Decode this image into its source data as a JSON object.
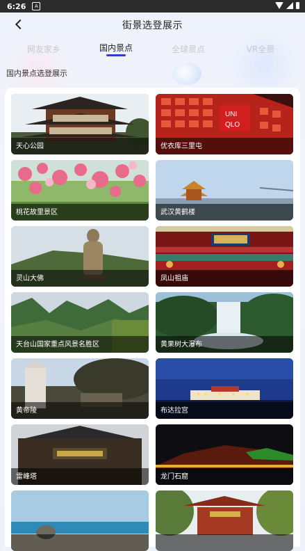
{
  "status_bar": {
    "time": "6:26",
    "notification_letter": "A"
  },
  "app_bar": {
    "title": "街景选登展示"
  },
  "tabs": [
    {
      "label": "网友家乡",
      "active": false
    },
    {
      "label": "国内景点",
      "active": true
    },
    {
      "label": "全球景点",
      "active": false
    },
    {
      "label": "VR全景",
      "active": false
    }
  ],
  "section": {
    "heading": "国内景点选登展示"
  },
  "colors": {
    "accent": "#2f3fc9",
    "inactive_tab": "#c5c8d3"
  },
  "spots": [
    {
      "label": "天心公园"
    },
    {
      "label": "优衣库三里屯"
    },
    {
      "label": "桃花故里景区"
    },
    {
      "label": "武汉黄鹤楼"
    },
    {
      "label": "灵山大佛"
    },
    {
      "label": "凤山祖庙"
    },
    {
      "label": "天台山国家重点风景名胜区"
    },
    {
      "label": "黄果树大瀑布"
    },
    {
      "label": "黄帝陵"
    },
    {
      "label": "布达拉宫"
    },
    {
      "label": "雷峰塔"
    },
    {
      "label": "龙门石窟"
    },
    {
      "label": ""
    },
    {
      "label": ""
    }
  ]
}
